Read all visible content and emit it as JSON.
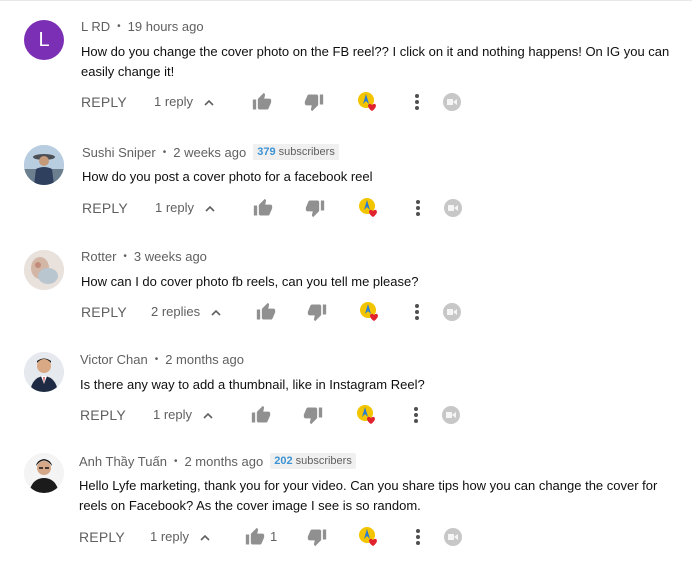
{
  "comments": [
    {
      "author": "L RD",
      "age": "19 hours ago",
      "avatar_letter": "L",
      "avatar_color": "#7b2fb5",
      "text": "How do you change the cover photo on the FB reel??  I click on it and nothing happens! On IG you can easily change it!",
      "reply_label": "REPLY",
      "replies_label": "1 reply"
    },
    {
      "author": "Sushi Sniper",
      "age": "2 weeks ago",
      "subscribers_count": "379",
      "subscribers_label": "subscribers",
      "text": "How do you post a cover photo for a facebook reel",
      "reply_label": "REPLY",
      "replies_label": "1 reply"
    },
    {
      "author": "Rotter",
      "age": "3 weeks ago",
      "text": "How can I do cover photo fb reels, can you tell me please?",
      "reply_label": "REPLY",
      "replies_label": "2 replies"
    },
    {
      "author": "Victor Chan",
      "age": "2 months ago",
      "text": "Is there any way to add a thumbnail, like in Instagram Reel?",
      "reply_label": "REPLY",
      "replies_label": "1 reply"
    },
    {
      "author": "Anh Thầy Tuấn",
      "age": "2 months ago",
      "subscribers_count": "202",
      "subscribers_label": "subscribers",
      "text": "Hello Lyfe marketing, thank you for your video. Can you share tips how you can change the cover for reels on Facebook? As the cover image I see is so random.",
      "reply_label": "REPLY",
      "replies_label": "1 reply",
      "like_count": "1"
    }
  ],
  "icons": {
    "like": "thumb-up-icon",
    "dislike": "thumb-down-icon",
    "heart": "creator-heart-icon",
    "more": "more-vert-icon",
    "extension": "extension-icon",
    "chevron": "chevron-up-icon"
  },
  "colors": {
    "meta_text": "#606060",
    "subscriber_count": "#3e93d3",
    "heart": "#e0232e"
  }
}
